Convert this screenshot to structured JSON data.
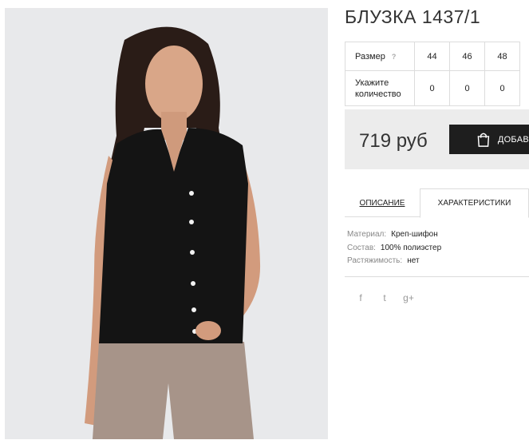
{
  "product": {
    "title": "БЛУЗКА 1437/1",
    "image_alt": "Black sleeveless blouse on model"
  },
  "sizes": {
    "label": "Размер",
    "help": "?",
    "options": [
      "44",
      "46",
      "48"
    ],
    "quantity_label_1": "Укажите",
    "quantity_label_2": "количество",
    "quantities": [
      "0",
      "0",
      "0"
    ]
  },
  "purchase": {
    "price": "719 руб",
    "cart_button": "ДОБАВ"
  },
  "tabs": [
    {
      "label": "ОПИСАНИЕ",
      "active": false
    },
    {
      "label": "ХАРАКТЕРИСТИКИ",
      "active": true
    }
  ],
  "characteristics": [
    {
      "key": "Материал:",
      "value": "Креп-шифон"
    },
    {
      "key": "Состав:",
      "value": "100% полиэстер"
    },
    {
      "key": "Растяжимость:",
      "value": "нет"
    }
  ],
  "social": [
    {
      "icon": "facebook-icon",
      "glyph": "f"
    },
    {
      "icon": "twitter-icon",
      "glyph": "t"
    },
    {
      "icon": "google-plus-icon",
      "glyph": "g+"
    }
  ]
}
